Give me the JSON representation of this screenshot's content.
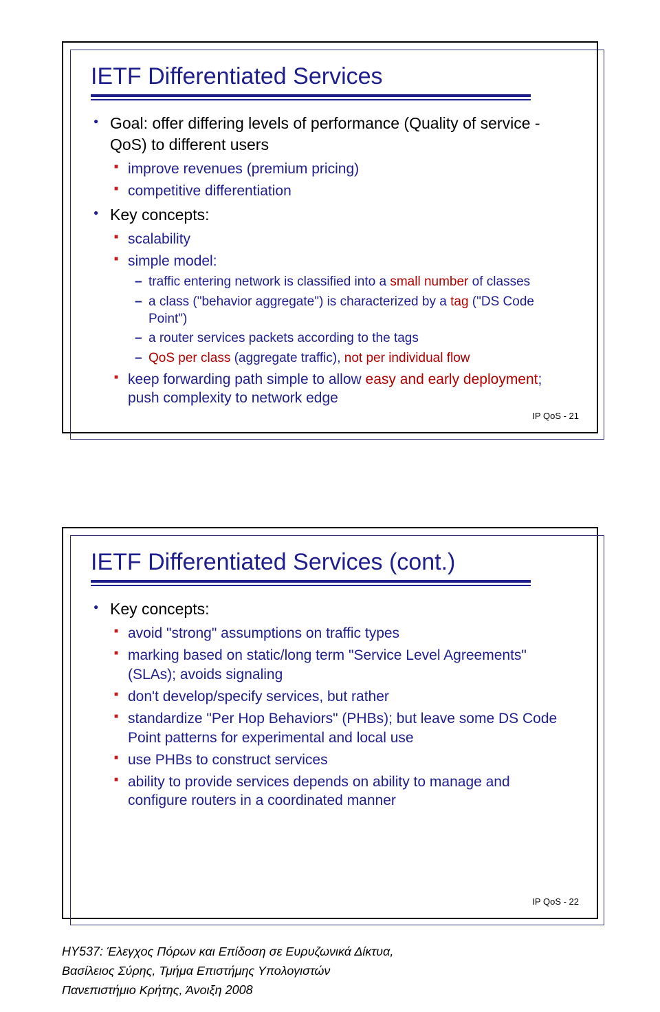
{
  "slide1": {
    "title": "IETF Differentiated Services",
    "b1": "Goal: offer differing levels of performance (Quality of service - QoS) to different users",
    "b1a": "improve revenues (premium pricing)",
    "b1b": "competitive differentiation",
    "b2": "Key concepts:",
    "b2a": "scalability",
    "b2b": "simple model:",
    "b2b1_a": "traffic entering network is classified into a ",
    "b2b1_b": "small number",
    "b2b1_c": " of classes",
    "b2b2_a": "a class (\"behavior aggregate\") is characterized by a ",
    "b2b2_b": "tag",
    "b2b2_c": " (\"DS Code Point\")",
    "b2b3": "a router services packets according to the tags",
    "b2b4_a": "QoS per class",
    "b2b4_b": " (aggregate traffic), ",
    "b2b4_c": "not per individual flow",
    "b2c_a": "keep forwarding path simple to allow ",
    "b2c_b": "easy and early deployment",
    "b2c_c": "; push complexity to network edge",
    "page": "IP QoS - 21"
  },
  "slide2": {
    "title": "IETF Differentiated Services (cont.)",
    "b1": "Key concepts:",
    "b1a": "avoid \"strong\" assumptions on traffic types",
    "b1b": "marking based on static/long term \"Service Level Agreements\" (SLAs); avoids signaling",
    "b1c": "don't develop/specify services, but rather",
    "b1d": "standardize \"Per Hop Behaviors\" (PHBs); but leave some DS Code Point patterns for experimental and local use",
    "b1e": "use PHBs to construct services",
    "b1f": "ability to provide services depends on ability to manage and configure routers in a coordinated manner",
    "page": "IP QoS - 22"
  },
  "footer": {
    "l1": "HY537: Έλεγχος Πόρων και Επίδοση σε Ευρυζωνικά Δίκτυα,",
    "l2": "Βασίλειος Σύρης, Τμήμα Επιστήμης Υπολογιστών",
    "l3": "Πανεπιστήμιο Κρήτης, Άνοιξη 2008"
  }
}
